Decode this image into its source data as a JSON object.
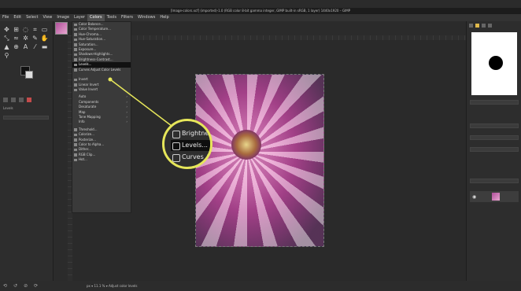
{
  "window": {
    "title": "[Image-colors.xcf] (imported)-1.0 (RGB color 8-bit gamma integer, GIMP built-in sRGB, 1 layer) 1440x1920 – GIMP"
  },
  "menubar": [
    "File",
    "Edit",
    "Select",
    "View",
    "Image",
    "Layer",
    "Colors",
    "Tools",
    "Filters",
    "Windows",
    "Help"
  ],
  "menubar_active": "Colors",
  "colors_menu": {
    "items": [
      {
        "label": "Color Balance...",
        "icon": true
      },
      {
        "label": "Color Temperature...",
        "icon": true
      },
      {
        "label": "Hue-Chroma...",
        "icon": true
      },
      {
        "label": "Hue-Saturation...",
        "icon": true
      },
      {
        "label": "Saturation...",
        "icon": true
      },
      {
        "label": "Exposure...",
        "icon": true
      },
      {
        "label": "Shadows-Highlights...",
        "icon": true
      },
      {
        "label": "Brightness-Contrast...",
        "icon": true
      },
      {
        "label": "Levels...",
        "icon": true,
        "highlighted": true
      },
      {
        "label": "Curves Adjust Color Levels",
        "icon": true
      },
      {
        "label": "",
        "icon": false
      },
      {
        "label": "Invert",
        "icon": true
      },
      {
        "label": "Linear Invert",
        "icon": true
      },
      {
        "label": "Value Invert",
        "icon": true
      },
      {
        "separator": true
      },
      {
        "label": "Auto",
        "submenu": true
      },
      {
        "label": "Components",
        "submenu": true
      },
      {
        "label": "Desaturate",
        "submenu": true
      },
      {
        "label": "Map",
        "submenu": true
      },
      {
        "label": "Tone Mapping",
        "submenu": true
      },
      {
        "label": "Info",
        "submenu": true
      },
      {
        "separator": true
      },
      {
        "label": "Threshold...",
        "icon": true
      },
      {
        "label": "Colorize...",
        "icon": true
      },
      {
        "label": "Posterize...",
        "icon": true
      },
      {
        "label": "Color to Alpha...",
        "icon": true
      },
      {
        "label": "Dither...",
        "icon": true
      },
      {
        "label": "RGB Clip...",
        "icon": true
      },
      {
        "label": "Hot...",
        "icon": true
      }
    ]
  },
  "zoom_callout": {
    "items": [
      {
        "label": "Brightne"
      },
      {
        "label": "Levels...",
        "highlighted": true
      },
      {
        "label": "Curves A"
      }
    ]
  },
  "status": {
    "text": "px  ▾  11.1 %  ▾  Adjust color levels"
  },
  "toolbox": {
    "options_title": "Levels"
  },
  "colors": {
    "accent_highlight": "#e6e65a",
    "menu_bg": "#3a3a3a",
    "menu_highlight": "#111111"
  }
}
